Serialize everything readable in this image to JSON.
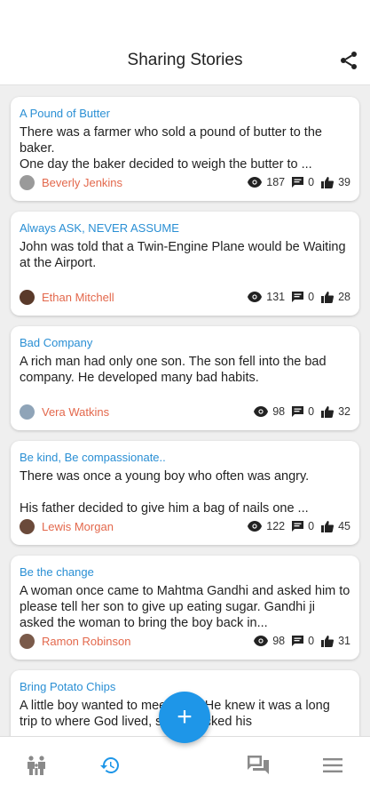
{
  "header": {
    "title": "Sharing Stories",
    "share_icon": "share-icon"
  },
  "stories": [
    {
      "title": "A Pound of Butter",
      "body": "There was a farmer who sold a pound of butter to the baker.\nOne day the baker decided to weigh the butter to ...",
      "author": "Beverly Jenkins",
      "views": "187",
      "comments": "0",
      "likes": "39",
      "avatar_color": "#9a9a9a"
    },
    {
      "title": "Always ASK, NEVER ASSUME",
      "body": "John was told that a Twin-Engine Plane would be Waiting at the Airport.",
      "author": "Ethan Mitchell",
      "views": "131",
      "comments": "0",
      "likes": "28",
      "avatar_color": "#5a3a2a"
    },
    {
      "title": "Bad Company",
      "body": "A rich man had only one son. The son fell into the bad company. He developed many bad habits.",
      "author": "Vera Watkins",
      "views": "98",
      "comments": "0",
      "likes": "32",
      "avatar_color": "#8fa4b8"
    },
    {
      "title": "Be kind, Be compassionate..",
      "body": "There was once a young boy who often was angry.\n\nHis father decided to give him a bag of nails one ...",
      "author": "Lewis Morgan",
      "views": "122",
      "comments": "0",
      "likes": "45",
      "avatar_color": "#6b4a3a"
    },
    {
      "title": "Be the change",
      "body": "A woman once came to Mahtma Gandhi and asked him to please tell her son to give up eating sugar. Gandhi ji asked the woman to bring the boy back in...",
      "author": "Ramon Robinson",
      "views": "98",
      "comments": "0",
      "likes": "31",
      "avatar_color": "#7a5a4a"
    },
    {
      "title": "Bring Potato Chips",
      "body": "A little boy wanted to meet God. He knew it was a long trip to where God lived, so he packed his",
      "author": "",
      "views": "",
      "comments": "",
      "likes": "",
      "avatar_color": "#999999"
    }
  ],
  "nav": {
    "items": [
      "community-icon",
      "history-icon",
      "add-icon",
      "forum-icon",
      "menu-icon"
    ],
    "active": "history-icon",
    "active_color": "#1e96e8",
    "inactive_color": "#8a8a8a",
    "fab_label": "+"
  }
}
